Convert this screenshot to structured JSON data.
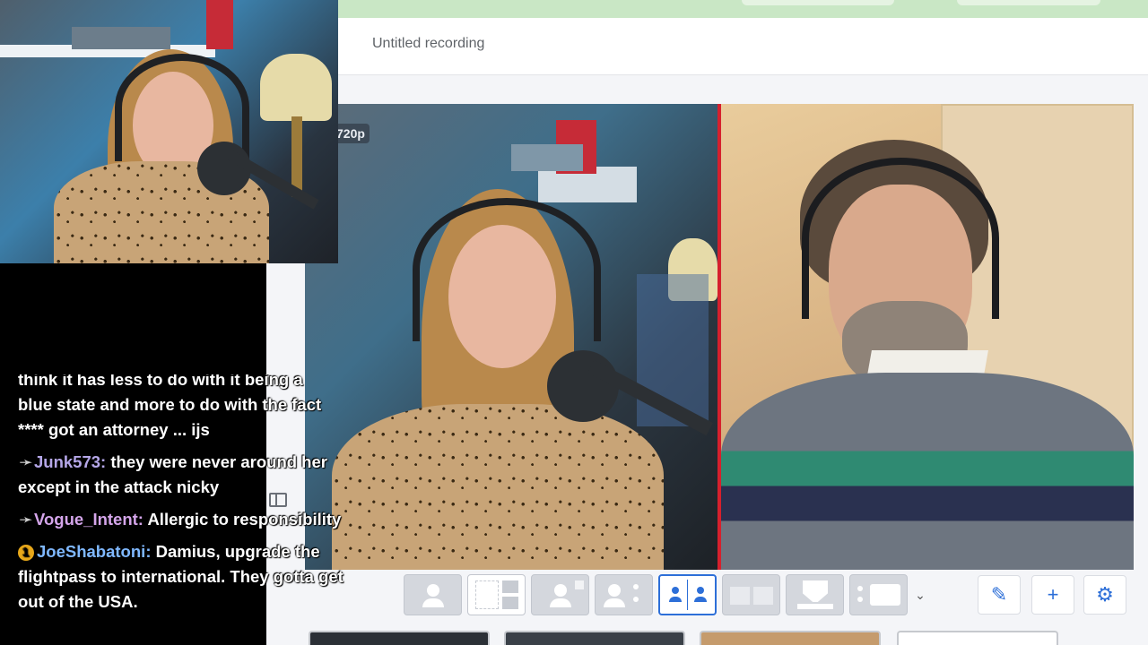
{
  "app": {
    "recording_title": "Untitled recording",
    "stage_resolution": "720p"
  },
  "layout_toolbar": {
    "buttons": [
      "solo-layout",
      "thumbnail-layout",
      "group-layout",
      "leader-layout",
      "split-layout",
      "cropped-layout",
      "news-layout",
      "screen-layout"
    ],
    "active": "split-layout",
    "tools": [
      "pencil-icon",
      "plus-icon",
      "gear-icon"
    ],
    "accent": "#2d6fd8"
  },
  "chat": {
    "messages": [
      {
        "user": "",
        "text": "think it has less to do with it being a",
        "partial": true
      },
      {
        "user": "",
        "text": "blue state and more to do with the fact",
        "partial": false
      },
      {
        "user": "",
        "text": "**** got an attorney ... ijs",
        "partial": false
      },
      {
        "user": "Junk573",
        "badge": "sword-icon",
        "color": "#b5a7e8",
        "text": "they were never around her except in the attack nicky"
      },
      {
        "user": "Vogue_Intent",
        "badge": "sword-icon",
        "color": "#d4a5ea",
        "text": "Allergic to responsibility"
      },
      {
        "user": "JoeShabatoni",
        "badge": "1",
        "color": "#7fb8ff",
        "text": "Damius, upgrade the flightpass to international. They gotta get out of the USA."
      }
    ]
  }
}
